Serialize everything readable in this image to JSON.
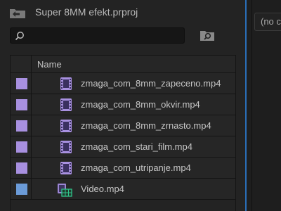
{
  "project": {
    "title": "Super 8MM efekt.prproj"
  },
  "search": {
    "value": "",
    "placeholder": ""
  },
  "list": {
    "name_column": "Name",
    "items": [
      {
        "name": "zmaga_com_8mm_zapeceno.mp4",
        "label_color": "#a890e0",
        "icon": "video-clip-icon"
      },
      {
        "name": "zmaga_com_8mm_okvir.mp4",
        "label_color": "#a890e0",
        "icon": "video-clip-icon"
      },
      {
        "name": "zmaga_com_8mm_zrnasto.mp4",
        "label_color": "#a890e0",
        "icon": "video-clip-icon"
      },
      {
        "name": "zmaga_com_stari_film.mp4",
        "label_color": "#a890e0",
        "icon": "video-clip-icon"
      },
      {
        "name": "zmaga_com_utripanje.mp4",
        "label_color": "#a890e0",
        "icon": "video-clip-icon"
      },
      {
        "name": "Video.mp4",
        "label_color": "#6b9bd8",
        "icon": "sequence-icon"
      }
    ]
  },
  "right_panel": {
    "dropdown_text": "(no c"
  },
  "colors": {
    "accent_divider": "#2a6fb8",
    "panel_bg": "#232323"
  }
}
